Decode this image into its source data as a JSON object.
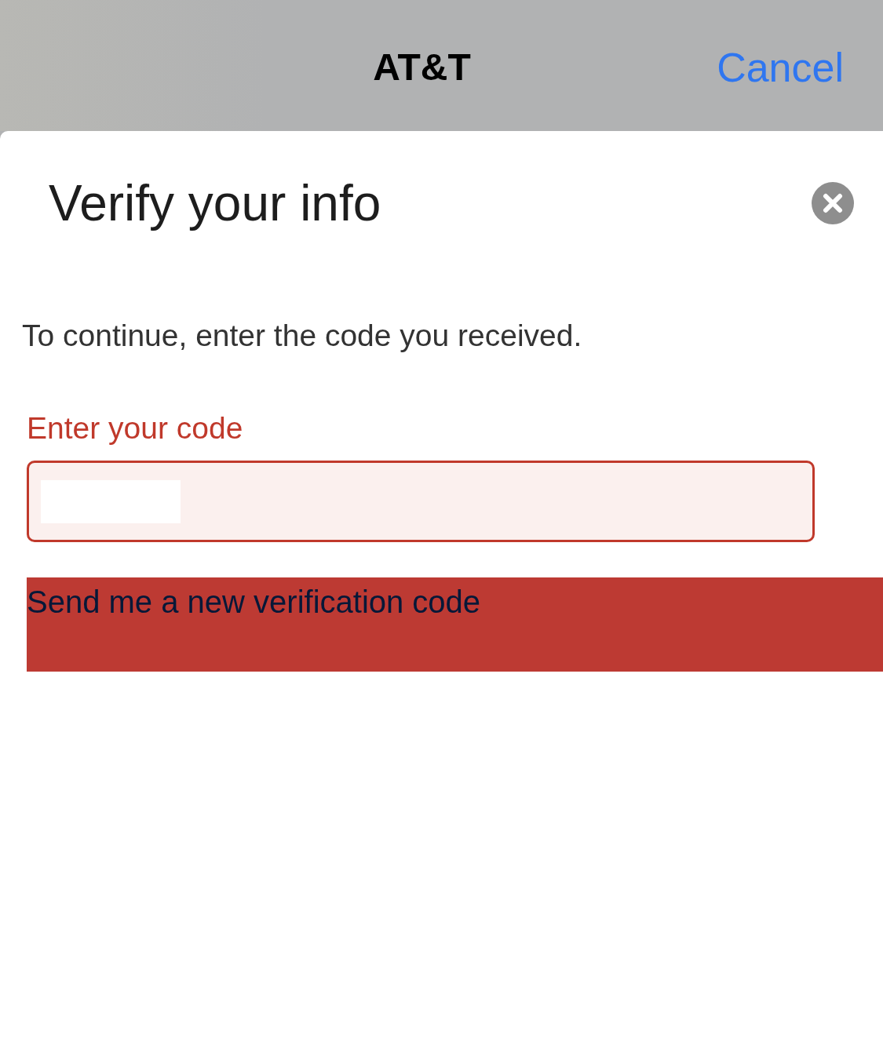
{
  "nav_bar": {
    "title": "AT&T",
    "cancel": "Cancel"
  },
  "sheet": {
    "title": "Verify your info",
    "instructions": "To continue, enter the code you received.",
    "code_field": {
      "label": "Enter your code",
      "error": true,
      "masked": true
    },
    "resend_button": "Send me a new verification code"
  }
}
